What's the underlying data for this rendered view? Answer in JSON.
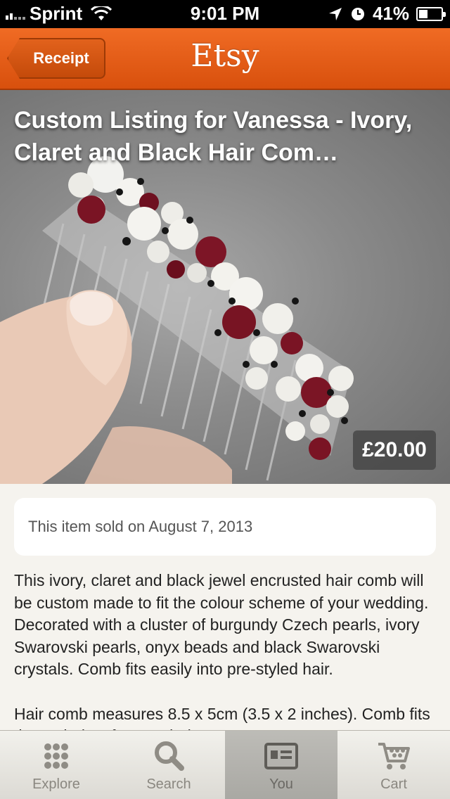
{
  "status_bar": {
    "carrier": "Sprint",
    "time": "9:01 PM",
    "battery_percent": "41%",
    "battery_level": 0.41
  },
  "nav": {
    "back_label": "Receipt",
    "title": "Etsy",
    "accent_color": "#e8601a"
  },
  "listing": {
    "title": "Custom Listing for Vanessa - Ivory, Claret and Black Hair Com…",
    "price": "£20.00",
    "sold_note": "This item sold on August 7, 2013",
    "description": "This ivory, claret and black jewel encrusted hair comb will be custom made to fit the colour scheme of your wedding. Decorated with a cluster of burgundy Czech pearls, ivory Swarovski pearls, onyx beads and black Swarovski crystals. Comb fits easily into pre-styled hair.\n\nHair comb measures 8.5 x 5cm (3.5 x 2 inches). Comb fits the majority of pre-styled"
  },
  "tabs": [
    {
      "label": "Explore",
      "icon": "grid-icon",
      "active": false
    },
    {
      "label": "Search",
      "icon": "search-icon",
      "active": false
    },
    {
      "label": "You",
      "icon": "id-card-icon",
      "active": true
    },
    {
      "label": "Cart",
      "icon": "cart-icon",
      "active": false
    }
  ]
}
